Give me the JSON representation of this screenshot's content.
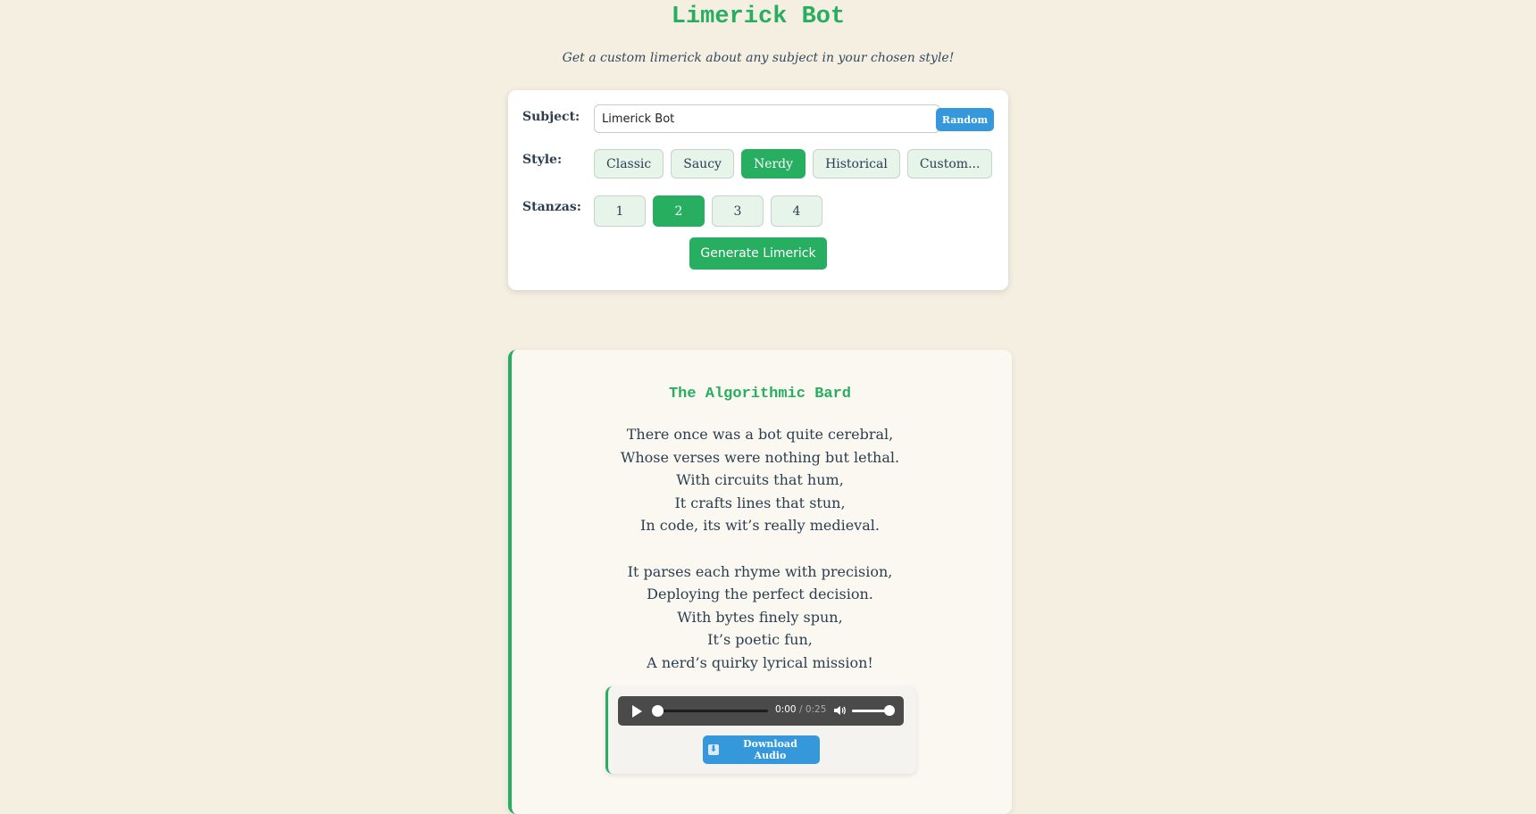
{
  "header": {
    "title": "Limerick Bot",
    "subtitle": "Get a custom limerick about any subject in your chosen style!"
  },
  "form": {
    "subject_label": "Subject:",
    "subject_value": "Limerick Bot",
    "random_label": "Random",
    "style_label": "Style:",
    "styles": [
      {
        "label": "Classic",
        "active": false
      },
      {
        "label": "Saucy",
        "active": false
      },
      {
        "label": "Nerdy",
        "active": true
      },
      {
        "label": "Historical",
        "active": false
      },
      {
        "label": "Custom...",
        "active": false
      }
    ],
    "stanzas_label": "Stanzas:",
    "stanzas": [
      {
        "label": "1",
        "active": false
      },
      {
        "label": "2",
        "active": true
      },
      {
        "label": "3",
        "active": false
      },
      {
        "label": "4",
        "active": false
      }
    ],
    "generate_label": "Generate Limerick"
  },
  "result": {
    "title": "The Algorithmic Bard",
    "stanzas": [
      [
        "There once was a bot quite cerebral,",
        "Whose verses were nothing but lethal.",
        "With circuits that hum,",
        "It crafts lines that stun,",
        "In code, its wit’s really medieval."
      ],
      [
        "It parses each rhyme with precision,",
        "Deploying the perfect decision.",
        "With bytes finely spun,",
        "It’s poetic fun,",
        "A nerd’s quirky lyrical mission!"
      ]
    ],
    "audio": {
      "current_time": "0:00",
      "total_time": "/ 0:25",
      "progress_fraction": 0,
      "volume_fraction": 1,
      "play_icon": "play-icon",
      "volume_icon": "volume-icon",
      "download_icon": "download-icon",
      "download_label": "Download Audio"
    }
  },
  "colors": {
    "background": "#f5efe2",
    "accent_green": "#27ae60",
    "accent_blue": "#3498db",
    "text": "#2c3e50"
  }
}
